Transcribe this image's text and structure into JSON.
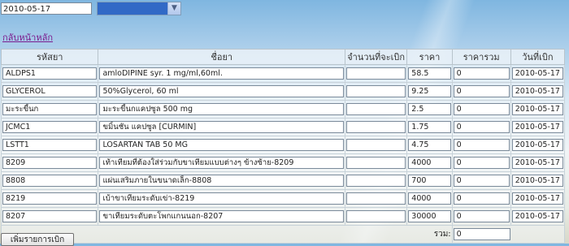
{
  "header": {
    "date_value": "2010-05-17",
    "select_value": ""
  },
  "back_link": "กลับหน้าหลัก",
  "table": {
    "columns": [
      "รหัสยา",
      "ชื่อยา",
      "จำนวนที่จะเบิก",
      "ราคา",
      "ราคารวม",
      "วันที่เบิก"
    ],
    "rows": [
      {
        "code": "ALDPS1",
        "name": "amloDIPINE syr. 1 mg/ml,60ml.",
        "qty": "",
        "price": "58.5",
        "total": "0",
        "date": "2010-05-17"
      },
      {
        "code": " GLYCEROL",
        "name": "50%Glycerol, 60 ml",
        "qty": "",
        "price": "9.25",
        "total": "0",
        "date": "2010-05-17"
      },
      {
        "code": "มะระขี้นก",
        "name": "มะระขี้นกแคปซูล 500 mg",
        "qty": "",
        "price": "2.5",
        "total": "0",
        "date": "2010-05-17"
      },
      {
        "code": "JCMC1",
        "name": "ขมิ้นชัน แคปซูล  [CURMIN]",
        "qty": "",
        "price": "1.75",
        "total": "0",
        "date": "2010-05-17"
      },
      {
        "code": "LSTT1",
        "name": "LOSARTAN TAB 50 MG",
        "qty": "",
        "price": "4.75",
        "total": "0",
        "date": "2010-05-17"
      },
      {
        "code": "8209",
        "name": "เท้าเทียมที่ต้องใส่ร่วมกับขาเทียมแบบต่างๆ ข้างซ้าย-8209",
        "qty": "",
        "price": "4000",
        "total": "0",
        "date": "2010-05-17"
      },
      {
        "code": "8808",
        "name": "แผ่นเสริมภายในขนาดเล็ก-8808",
        "qty": "",
        "price": "700",
        "total": "0",
        "date": "2010-05-17"
      },
      {
        "code": "8219",
        "name": "เบ้าขาเทียมระดับเข่า-8219",
        "qty": "",
        "price": "4000",
        "total": "0",
        "date": "2010-05-17"
      },
      {
        "code": "8207",
        "name": "ขาเทียมระดับตะโพกแกนนอก-8207",
        "qty": "",
        "price": "30000",
        "total": "0",
        "date": "2010-05-17"
      }
    ],
    "sum_label": "รวม:",
    "sum_value": "0"
  },
  "add_button": "เพิ่มรายการเบิก",
  "icons": {
    "select_arrow": "chevron-down-icon"
  },
  "colors": {
    "select_highlight": "#3169c6",
    "link": "#7b1c8e"
  }
}
